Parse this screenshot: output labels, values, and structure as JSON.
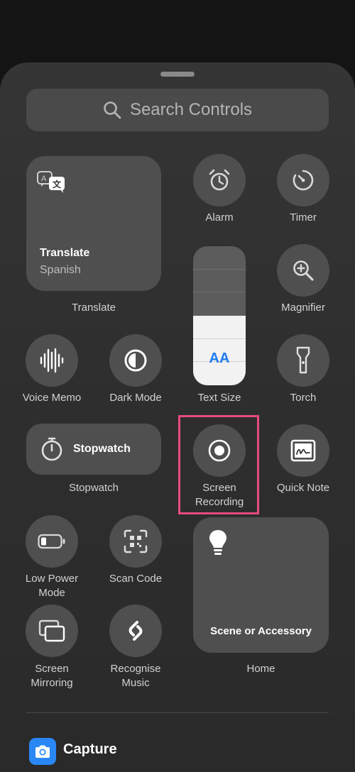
{
  "search": {
    "placeholder": "Search Controls"
  },
  "controls": {
    "translate": {
      "title": "Translate",
      "subtitle": "Spanish",
      "label": "Translate"
    },
    "alarm": {
      "label": "Alarm"
    },
    "timer": {
      "label": "Timer"
    },
    "magnifier": {
      "label": "Magnifier"
    },
    "text_size": {
      "label": "Text Size",
      "glyph": "AA",
      "level": 0.5
    },
    "voice_memo": {
      "label": "Voice Memo"
    },
    "dark_mode": {
      "label": "Dark Mode"
    },
    "torch": {
      "label": "Torch"
    },
    "stopwatch": {
      "title": "Stopwatch",
      "label": "Stopwatch"
    },
    "screen_recording": {
      "label_line1": "Screen",
      "label_line2": "Recording"
    },
    "quick_note": {
      "label": "Quick Note"
    },
    "low_power": {
      "label_line1": "Low Power",
      "label_line2": "Mode"
    },
    "scan_code": {
      "label": "Scan Code"
    },
    "home": {
      "title": "Scene or Accessory",
      "label": "Home"
    },
    "screen_mirroring": {
      "label_line1": "Screen",
      "label_line2": "Mirroring"
    },
    "recognise_music": {
      "label_line1": "Recognise",
      "label_line2": "Music"
    }
  },
  "section": {
    "title": "Capture"
  },
  "colors": {
    "accent_blue": "#1e7bf0",
    "highlight": "#e64b82",
    "capture_icon_bg": "#2a88f6"
  }
}
